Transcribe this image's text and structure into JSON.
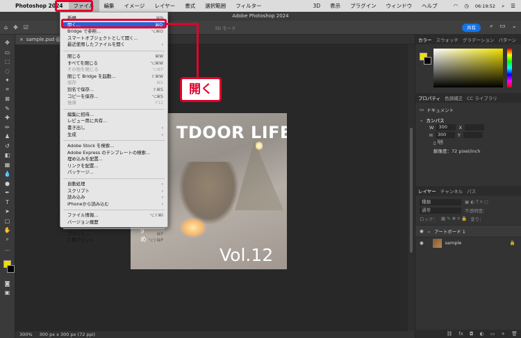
{
  "mac_menubar": {
    "app_name": "Photoshop 2024",
    "items": [
      "ファイル",
      "編集",
      "イメージ",
      "レイヤー",
      "書式",
      "選択範囲",
      "フィルター",
      "3D",
      "表示",
      "プラグイン",
      "ウィンドウ",
      "ヘルプ"
    ],
    "clock": "06:19:52"
  },
  "window_title": "Adobe Photoshop 2024",
  "optionsbar": {
    "share_label": "共有",
    "mode_3d": "3D モード"
  },
  "document": {
    "tab_name": "sample.psd @ 3",
    "zoom": "300%",
    "doc_info": "300 px x 300 px (72 ppi)"
  },
  "artboard_text": {
    "title": "TDOOR LIFE",
    "volume": "Vol.12",
    "small": "9\nめ"
  },
  "file_menu": {
    "groups": [
      [
        {
          "label": "新規...",
          "shortcut": "⌘N",
          "disabled": false
        },
        {
          "label": "開く...",
          "shortcut": "⌘O",
          "disabled": false,
          "highlight": true
        },
        {
          "label": "Bridge で参照...",
          "shortcut": "⌥⌘O",
          "disabled": false
        },
        {
          "label": "スマートオブジェクトとして開く...",
          "shortcut": "",
          "disabled": false
        },
        {
          "label": "最近使用したファイルを開く",
          "shortcut": "›",
          "disabled": false
        }
      ],
      [
        {
          "label": "閉じる",
          "shortcut": "⌘W",
          "disabled": false
        },
        {
          "label": "すべてを閉じる",
          "shortcut": "⌥⌘W",
          "disabled": false
        },
        {
          "label": "その他を閉じる",
          "shortcut": "⌥⌘P",
          "disabled": true
        },
        {
          "label": "閉じて Bridge を起動...",
          "shortcut": "⇧⌘W",
          "disabled": false
        },
        {
          "label": "保存",
          "shortcut": "⌘S",
          "disabled": true
        },
        {
          "label": "別名で保存...",
          "shortcut": "⇧⌘S",
          "disabled": false
        },
        {
          "label": "コピーを保存...",
          "shortcut": "⌥⌘S",
          "disabled": false
        },
        {
          "label": "復帰",
          "shortcut": "F12",
          "disabled": true
        }
      ],
      [
        {
          "label": "編集に招待...",
          "shortcut": "",
          "disabled": false
        },
        {
          "label": "レビュー用に共有...",
          "shortcut": "",
          "disabled": false
        },
        {
          "label": "書き出し",
          "shortcut": "›",
          "disabled": false
        },
        {
          "label": "生成",
          "shortcut": "›",
          "disabled": false
        }
      ],
      [
        {
          "label": "Adobe Stock を検索...",
          "shortcut": "",
          "disabled": false
        },
        {
          "label": "Adobe Express のテンプレートの検索...",
          "shortcut": "",
          "disabled": false
        },
        {
          "label": "埋め込みを配置...",
          "shortcut": "",
          "disabled": false
        },
        {
          "label": "リンクを配置...",
          "shortcut": "",
          "disabled": false
        },
        {
          "label": "パッケージ...",
          "shortcut": "",
          "disabled": false
        }
      ],
      [
        {
          "label": "自動処理",
          "shortcut": "›",
          "disabled": false
        },
        {
          "label": "スクリプト",
          "shortcut": "›",
          "disabled": false
        },
        {
          "label": "読み込み",
          "shortcut": "›",
          "disabled": false
        },
        {
          "label": "iPhoneから読み込む",
          "shortcut": "›",
          "disabled": false
        }
      ],
      [
        {
          "label": "ファイル情報...",
          "shortcut": "⌥⇧⌘I",
          "disabled": false
        },
        {
          "label": "バージョン履歴",
          "shortcut": "",
          "disabled": false
        }
      ],
      [
        {
          "label": "プリント...",
          "shortcut": "⌘P",
          "disabled": false
        },
        {
          "label": "1 部プリント",
          "shortcut": "⌥⇧⌘P",
          "disabled": false
        }
      ]
    ]
  },
  "callout_label": "開く",
  "panels": {
    "color_tabs": [
      "カラー",
      "スウォッチ",
      "グラデーション",
      "パターン"
    ],
    "property_tabs": [
      "プロパティ",
      "色調補正",
      "CC ライブラリ"
    ],
    "doc_label": "ドキュメント",
    "canvas_label": "カンバス",
    "w_label": "W",
    "w_value": "300 px",
    "x_label": "X",
    "h_label": "H",
    "h_value": "300 px",
    "y_label": "Y",
    "resolution": "解像度：72 pixel/inch",
    "layer_tabs": [
      "レイヤー",
      "チャンネル",
      "パス"
    ],
    "kind_label": "種類",
    "blend_mode": "通常",
    "opacity_label": "不透明度：",
    "lock_label": "ロック：",
    "fill_label": "塗り：",
    "layers": [
      {
        "name": "アートボード 1",
        "type": "artboard"
      },
      {
        "name": "sample",
        "type": "layer"
      }
    ]
  },
  "colors": {
    "accent_red": "#e4002b",
    "highlight_blue": "#2862d6",
    "foreground": "#f0e000"
  }
}
